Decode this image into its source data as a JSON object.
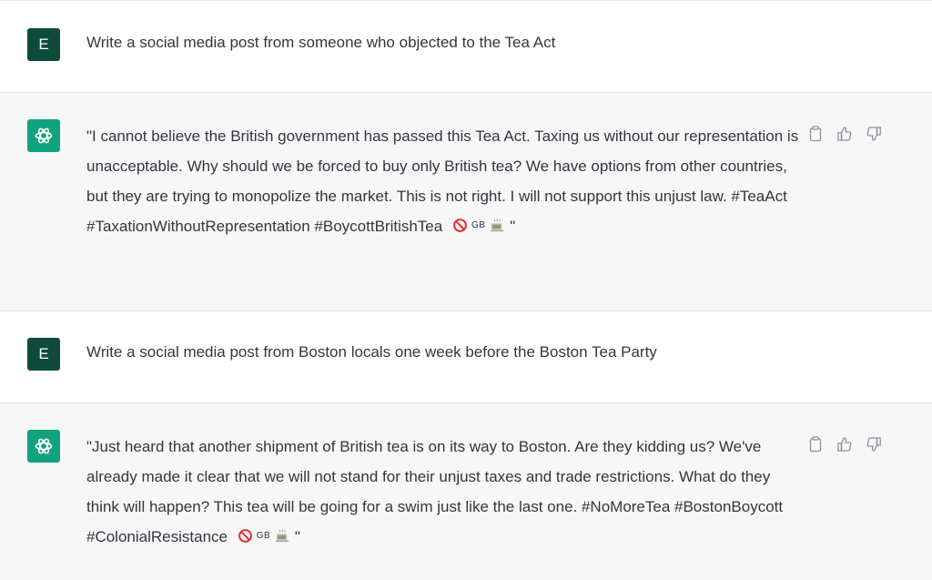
{
  "conversation": [
    {
      "role": "user",
      "avatar_letter": "E",
      "text": "Write a social media post from someone who objected to the Tea Act"
    },
    {
      "role": "assistant",
      "text": "\"I cannot believe the British government has passed this Tea Act. Taxing us without our representation is unacceptable. Why should we be forced to buy only British tea? We have options from other countries, but they are trying to monopolize the market. This is not right. I will not support this unjust law. #TeaAct #TaxationWithoutRepresentation #BoycottBritishTea",
      "emoji": {
        "no_sign": "prohibited-icon",
        "flag_label": "GB",
        "cup": "teacup-icon"
      },
      "closing_quote": "\""
    },
    {
      "role": "user",
      "avatar_letter": "E",
      "text": "Write a social media post from Boston locals one week before the Boston Tea Party"
    },
    {
      "role": "assistant",
      "text": "\"Just heard that another shipment of British tea is on its way to Boston. Are they kidding us? We've already made it clear that we will not stand for their unjust taxes and trade restrictions. What do they think will happen? This tea will be going for a swim just like the last one. #NoMoreTea #BostonBoycott #ColonialResistance",
      "emoji": {
        "no_sign": "prohibited-icon",
        "flag_label": "GB",
        "cup": "teacup-icon"
      },
      "closing_quote": "\""
    }
  ],
  "colors": {
    "user_avatar": "#0f4b3a",
    "assistant_avatar": "#10a37f",
    "assistant_bg": "#f7f7f8",
    "text": "#343541",
    "icon": "#8e8ea0",
    "prohibited": "#e0312f"
  },
  "actions": [
    "copy-icon",
    "thumbs-up-icon",
    "thumbs-down-icon"
  ]
}
